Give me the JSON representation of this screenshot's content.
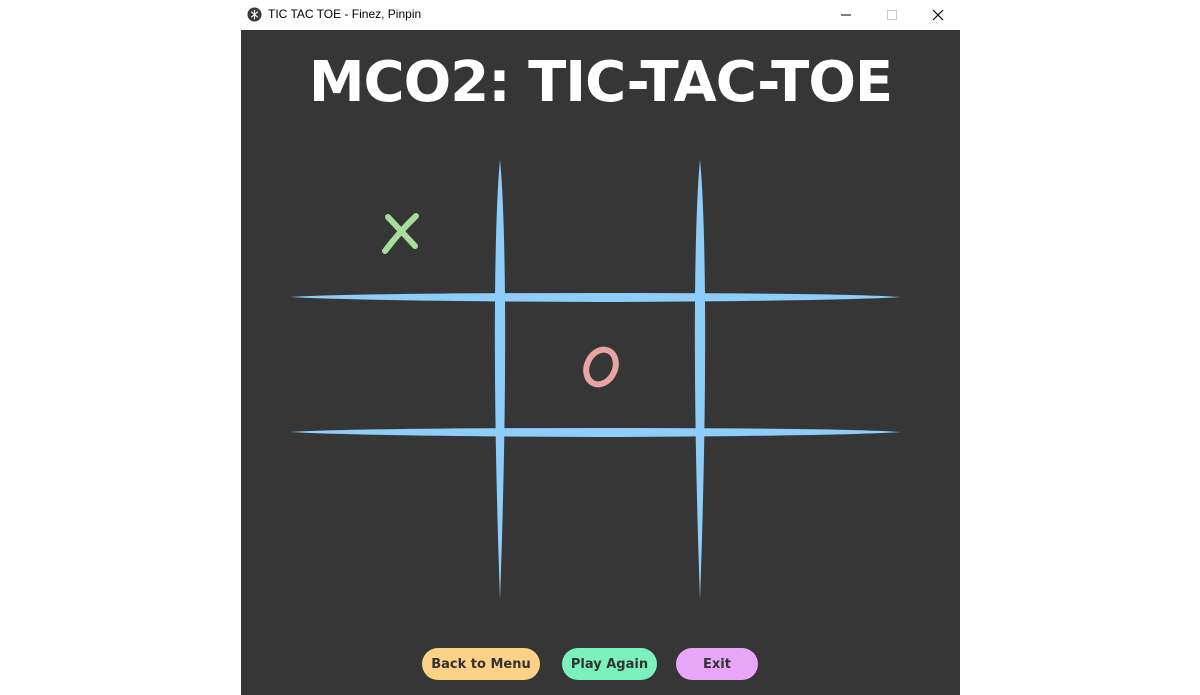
{
  "window": {
    "title": "TIC TAC TOE - Finez, Pinpin",
    "icon": "app-logo-icon",
    "controls": {
      "minimize": "minimize-icon",
      "maximize": "maximize-icon",
      "close": "close-icon"
    }
  },
  "game": {
    "heading": "MCO2: TIC-TAC-TOE",
    "board": {
      "rows": [
        [
          "X",
          "",
          ""
        ],
        [
          "",
          "O",
          ""
        ],
        [
          "",
          "",
          ""
        ]
      ]
    },
    "marks": {
      "x_label": "X",
      "o_label": "O"
    }
  },
  "buttons": {
    "back_to_menu": "Back to Menu",
    "play_again": "Play Again",
    "exit": "Exit"
  },
  "colors": {
    "background": "#363636",
    "grid": "#8ecdf7",
    "x_mark": "#a8dc9c",
    "o_mark": "#e8a3a3",
    "heading": "#ffffff",
    "btn_menu": "#fdd186",
    "btn_again": "#7cf0bd",
    "btn_exit": "#e7a6f7"
  }
}
